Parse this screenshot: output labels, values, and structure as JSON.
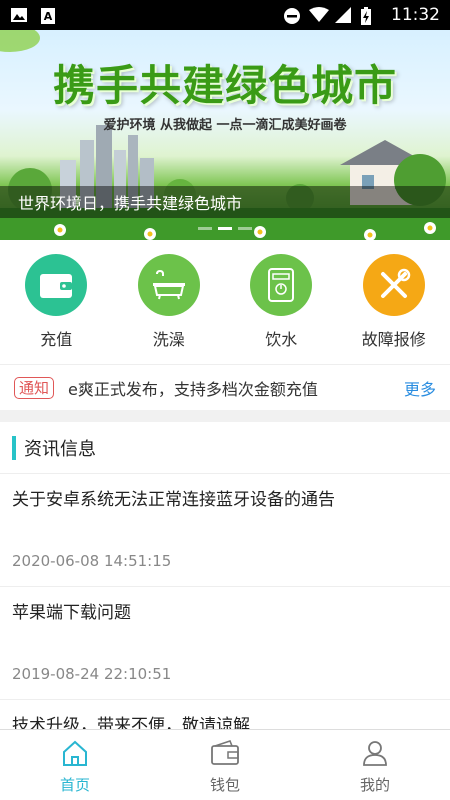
{
  "status_bar": {
    "time": "11:32",
    "icons": [
      "image-icon",
      "font-icon",
      "dnd-icon",
      "wifi-icon",
      "signal-icon",
      "battery-icon"
    ]
  },
  "banner": {
    "title": "携手共建绿色城市",
    "subtitle": "爱护环境 从我做起 一点一滴汇成美好画卷",
    "caption": "世界环境日，携手共建绿色城市",
    "slide_count": 3,
    "active_slide": 2
  },
  "quick_menu": [
    {
      "label": "充值",
      "icon": "wallet-icon",
      "color": "#2cc293"
    },
    {
      "label": "洗澡",
      "icon": "bathtub-icon",
      "color": "#6cc24a"
    },
    {
      "label": "饮水",
      "icon": "water-dispenser-icon",
      "color": "#6cc24a"
    },
    {
      "label": "故障报修",
      "icon": "repair-tools-icon",
      "color": "#f5a815"
    }
  ],
  "notice": {
    "tag": "通知",
    "text": "e爽正式发布，支持多档次金额充值",
    "more": "更多"
  },
  "news": {
    "header": "资讯信息",
    "items": [
      {
        "title": "关于安卓系统无法正常连接蓝牙设备的通告",
        "date": "2020-06-08 14:51:15"
      },
      {
        "title": "苹果端下载问题",
        "date": "2019-08-24 22:10:51"
      },
      {
        "title": "技术升级，带来不便，敬请谅解",
        "date": ""
      }
    ]
  },
  "tabs": [
    {
      "label": "首页",
      "icon": "home-icon",
      "active": true
    },
    {
      "label": "钱包",
      "icon": "wallet-outline-icon",
      "active": false
    },
    {
      "label": "我的",
      "icon": "user-icon",
      "active": false
    }
  ],
  "colors": {
    "accent": "#29b6d1",
    "notice_tag": "#e05757",
    "link": "#2a8de0",
    "news_bar": "#27c3c8"
  }
}
